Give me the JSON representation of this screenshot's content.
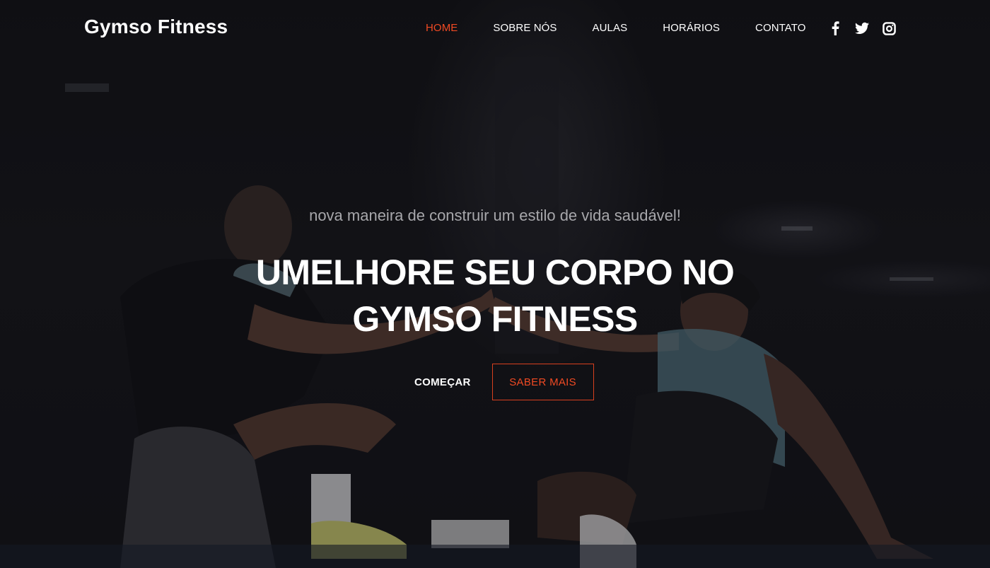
{
  "brand": {
    "name": "Gymso Fitness"
  },
  "nav": {
    "items": [
      {
        "label": "HOME",
        "active": true
      },
      {
        "label": "SOBRE NÓS",
        "active": false
      },
      {
        "label": "AULAS",
        "active": false
      },
      {
        "label": "HORÁRIOS",
        "active": false
      },
      {
        "label": "CONTATO",
        "active": false
      }
    ],
    "social": [
      {
        "icon": "facebook-icon"
      },
      {
        "icon": "twitter-icon"
      },
      {
        "icon": "instagram-icon"
      }
    ]
  },
  "hero": {
    "subtitle": "nova maneira de construir um estilo de vida saudável!",
    "title": "UMELHORE SEU CORPO NO GYMSO FITNESS",
    "primary_cta": "COMEÇAR",
    "secondary_cta": "SABER MAIS"
  },
  "colors": {
    "accent": "#f04a23",
    "background": "#141418",
    "text": "#ffffff",
    "subtitle": "#a7a7ab"
  }
}
